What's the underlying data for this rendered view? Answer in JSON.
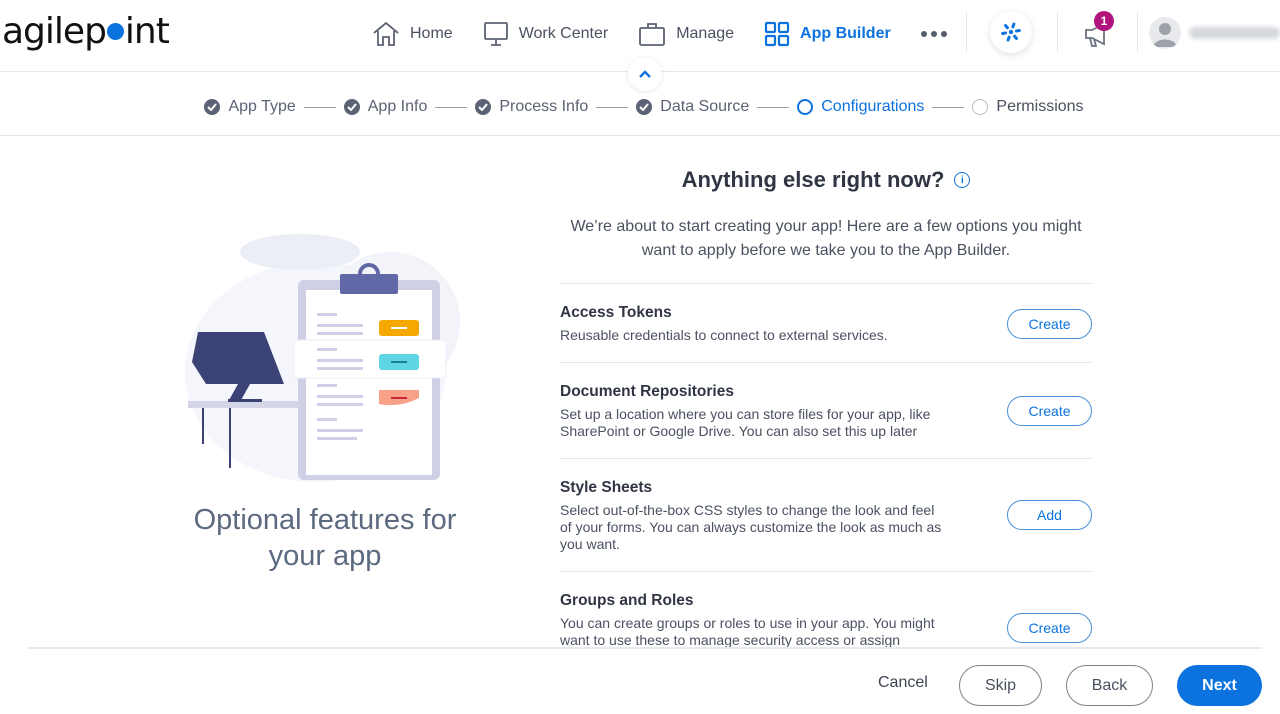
{
  "header": {
    "logo": {
      "prefix": "agilep",
      "suffix": "int"
    },
    "nav": [
      {
        "label": "Home",
        "icon": "home-icon",
        "active": false
      },
      {
        "label": "Work Center",
        "icon": "monitor-icon",
        "active": false
      },
      {
        "label": "Manage",
        "icon": "briefcase-icon",
        "active": false
      },
      {
        "label": "App Builder",
        "icon": "grid-icon",
        "active": true
      }
    ],
    "more_icon": "more-dots-icon",
    "notification_count": "1",
    "accent_color": "#0b72de",
    "badge_color": "#b0157e"
  },
  "stepper": {
    "steps": [
      {
        "label": "App Type",
        "state": "done"
      },
      {
        "label": "App Info",
        "state": "done"
      },
      {
        "label": "Process Info",
        "state": "done"
      },
      {
        "label": "Data Source",
        "state": "done"
      },
      {
        "label": "Configurations",
        "state": "current"
      },
      {
        "label": "Permissions",
        "state": "pending"
      }
    ]
  },
  "left": {
    "title": "Optional features for your app"
  },
  "main": {
    "title": "Anything else right now?",
    "info_icon": "i",
    "intro": "We’re about to start creating your app! Here are a few options you might want to apply before we take you to the App Builder.",
    "options": [
      {
        "title": "Access Tokens",
        "description": "Reusable credentials to connect to external services.",
        "button": "Create"
      },
      {
        "title": "Document Repositories",
        "description": "Set up a location where you can store files for your app, like SharePoint or Google Drive. You can also set this up later",
        "button": "Create"
      },
      {
        "title": "Style Sheets",
        "description": "Select out-of-the-box CSS styles to change the look and feel of your forms. You can always customize the look as much as you want.",
        "button": "Add"
      },
      {
        "title": "Groups and Roles",
        "description": "You can create groups or roles to use in your app. You might want to use these to manage security access or assign",
        "button": "Create"
      }
    ]
  },
  "footer": {
    "cancel": "Cancel",
    "skip": "Skip",
    "back": "Back",
    "next": "Next"
  }
}
